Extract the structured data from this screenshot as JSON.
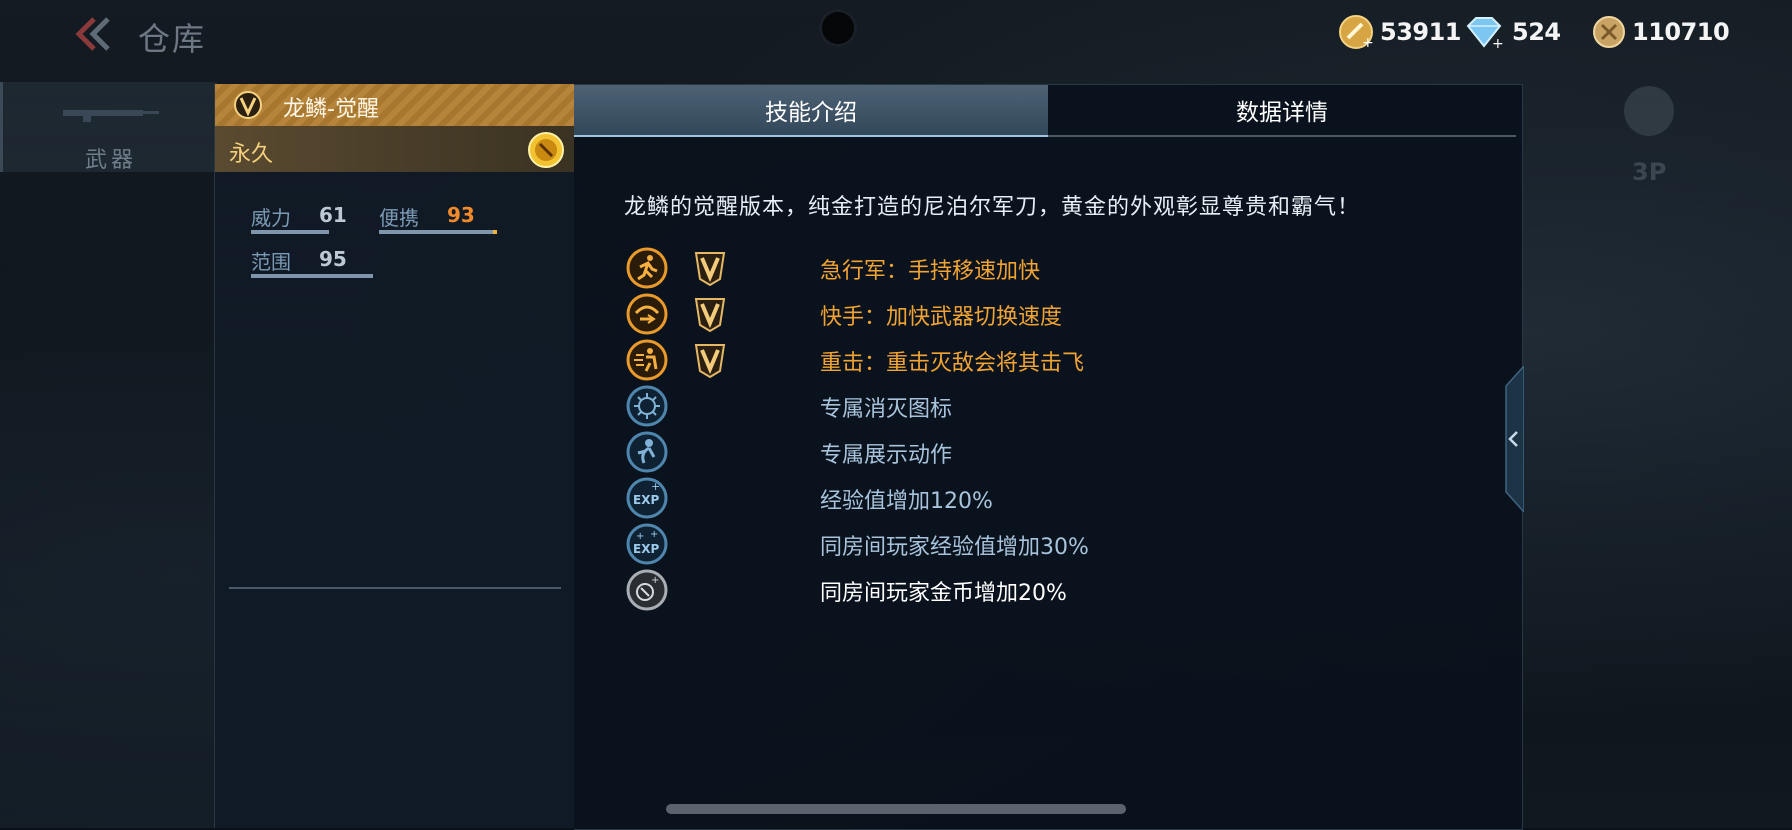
{
  "header": {
    "title": "仓库",
    "currencies": [
      {
        "icon": "gold-coin-icon",
        "value": "53911"
      },
      {
        "icon": "diamond-icon",
        "value": "524"
      },
      {
        "icon": "medal-coin-icon",
        "value": "110710"
      }
    ]
  },
  "sidebar": {
    "weapon_tab_label": "武器"
  },
  "weapon": {
    "name": "龙鳞-觉醒",
    "duration": "永久",
    "stats": [
      {
        "label": "威力",
        "value": "61"
      },
      {
        "label": "便携",
        "value": "93"
      },
      {
        "label": "范围",
        "value": "95"
      }
    ]
  },
  "tabs": [
    {
      "label": "技能介绍",
      "active": true
    },
    {
      "label": "数据详情",
      "active": false
    }
  ],
  "skills": {
    "description": "龙鳞的觉醒版本，纯金打造的尼泊尔军刀，黄金的外观彰显尊贵和霸气！",
    "perks": [
      {
        "icon": "sprint-icon",
        "text": "急行军：手持移速加快",
        "style": "gold",
        "vip": true
      },
      {
        "icon": "quick-hand-icon",
        "text": "快手：加快武器切换速度",
        "style": "gold",
        "vip": true
      },
      {
        "icon": "heavy-hit-icon",
        "text": "重击：重击灭敌会将其击飞",
        "style": "gold",
        "vip": true
      },
      {
        "icon": "kill-icon-badge-icon",
        "text": "专属消灭图标",
        "style": "blue",
        "vip": false
      },
      {
        "icon": "display-action-icon",
        "text": "专属展示动作",
        "style": "blue",
        "vip": false
      },
      {
        "icon": "exp-icon",
        "text": "经验值增加120%",
        "style": "blue",
        "vip": false
      },
      {
        "icon": "team-exp-icon",
        "text": "同房间玩家经验值增加30%",
        "style": "blue",
        "vip": false
      },
      {
        "icon": "team-gold-icon",
        "text": "同房间玩家金币增加20%",
        "style": "white",
        "vip": false
      }
    ]
  },
  "view_toggle": {
    "label": "3P"
  },
  "colors": {
    "gold_text": "#f2a433",
    "blue_text": "#a8c4dc",
    "header_gold": "#b6843a",
    "portability_value": "#f08a2a"
  }
}
